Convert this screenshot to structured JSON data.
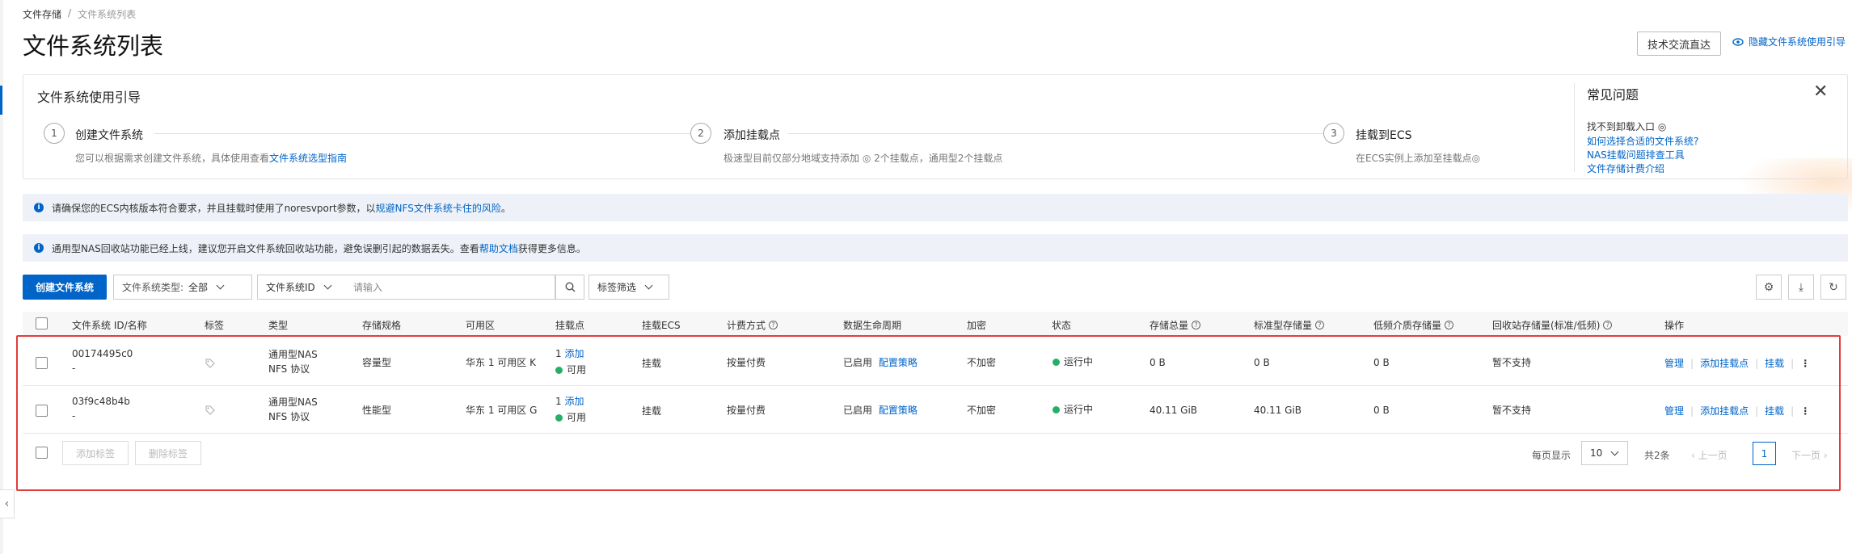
{
  "breadcrumb": {
    "root": "文件存储",
    "sep": "/",
    "current": "文件系统列表"
  },
  "page_title": "文件系统列表",
  "header": {
    "tech_btn": "技术交流直达",
    "hide_guide": "隐藏文件系统使用引导"
  },
  "guide": {
    "title": "文件系统使用引导",
    "steps": [
      {
        "num": "1",
        "title": "创建文件系统",
        "desc_pre": "您可以根据需求创建文件系统，具体使用查看",
        "desc_link": "文件系统选型指南"
      },
      {
        "num": "2",
        "title": "添加挂载点",
        "desc": "极速型目前仅部分地域支持添加 ◎ 2个挂载点，通用型2个挂载点"
      },
      {
        "num": "3",
        "title": "挂载到ECS",
        "desc": "在ECS实例上添加至挂载点◎"
      }
    ],
    "faq_title": "常见问题",
    "faq": [
      "找不到卸载入口 ◎",
      "如何选择合适的文件系统?",
      "NAS挂载问题排查工具",
      "文件存储计费介绍"
    ]
  },
  "notices": [
    {
      "pre": "请确保您的ECS内核版本符合要求，并且挂载时使用了noresvport参数，以",
      "link": "规避NFS文件系统卡住的风险",
      "post": "。"
    },
    {
      "pre": "通用型NAS回收站功能已经上线，建议您开启文件系统回收站功能，避免误删引起的数据丢失。查看",
      "link": "帮助文档",
      "post": "获得更多信息。"
    }
  ],
  "toolbar": {
    "create_btn": "创建文件系统",
    "type_label": "文件系统类型:",
    "type_value": "全部",
    "id_label": "文件系统ID",
    "search_placeholder": "请输入",
    "tag_filter": "标签筛选"
  },
  "table": {
    "headers": {
      "id": "文件系统 ID/名称",
      "tag": "标签",
      "type": "类型",
      "spec": "存储规格",
      "zone": "可用区",
      "mount": "挂载点",
      "ecs": "挂载ECS",
      "billing": "计费方式",
      "lifecycle": "数据生命周期",
      "encrypt": "加密",
      "status": "状态",
      "total": "存储总量",
      "standard": "标准型存储量",
      "low": "低频介质存储量",
      "recycle": "回收站存储量(标准/低频)",
      "ops": "操作"
    },
    "rows": [
      {
        "id": "00174495c0",
        "name": "-",
        "type1": "通用型NAS",
        "type2": "NFS 协议",
        "spec": "容量型",
        "zone": "华东 1 可用区 K",
        "mount_count": "1",
        "mount_add": "添加",
        "mount_status": "可用",
        "ecs": "挂载",
        "billing": "按量付费",
        "lifecycle": "已启用",
        "lifecycle_link": "配置策略",
        "encrypt": "不加密",
        "status": "运行中",
        "total": "0 B",
        "standard": "0 B",
        "low": "0 B",
        "recycle": "暂不支持",
        "op_manage": "管理",
        "op_add": "添加挂载点",
        "op_mount": "挂载"
      },
      {
        "id": "03f9c48b4b",
        "name": "-",
        "type1": "通用型NAS",
        "type2": "NFS 协议",
        "spec": "性能型",
        "zone": "华东 1 可用区 G",
        "mount_count": "1",
        "mount_add": "添加",
        "mount_status": "可用",
        "ecs": "挂载",
        "billing": "按量付费",
        "lifecycle": "已启用",
        "lifecycle_link": "配置策略",
        "encrypt": "不加密",
        "status": "运行中",
        "total": "40.11 GiB",
        "standard": "40.11 GiB",
        "low": "0 B",
        "recycle": "暂不支持",
        "op_manage": "管理",
        "op_add": "添加挂载点",
        "op_mount": "挂载"
      }
    ]
  },
  "footer": {
    "add_tag": "添加标签",
    "del_tag": "删除标签",
    "per_page_label": "每页显示",
    "per_page": "10",
    "total": "共2条",
    "prev": "上一页",
    "page": "1",
    "next": "下一页"
  },
  "colors": {
    "primary": "#0064c8",
    "running": "#23b066",
    "highlight": "#e33b3b"
  }
}
